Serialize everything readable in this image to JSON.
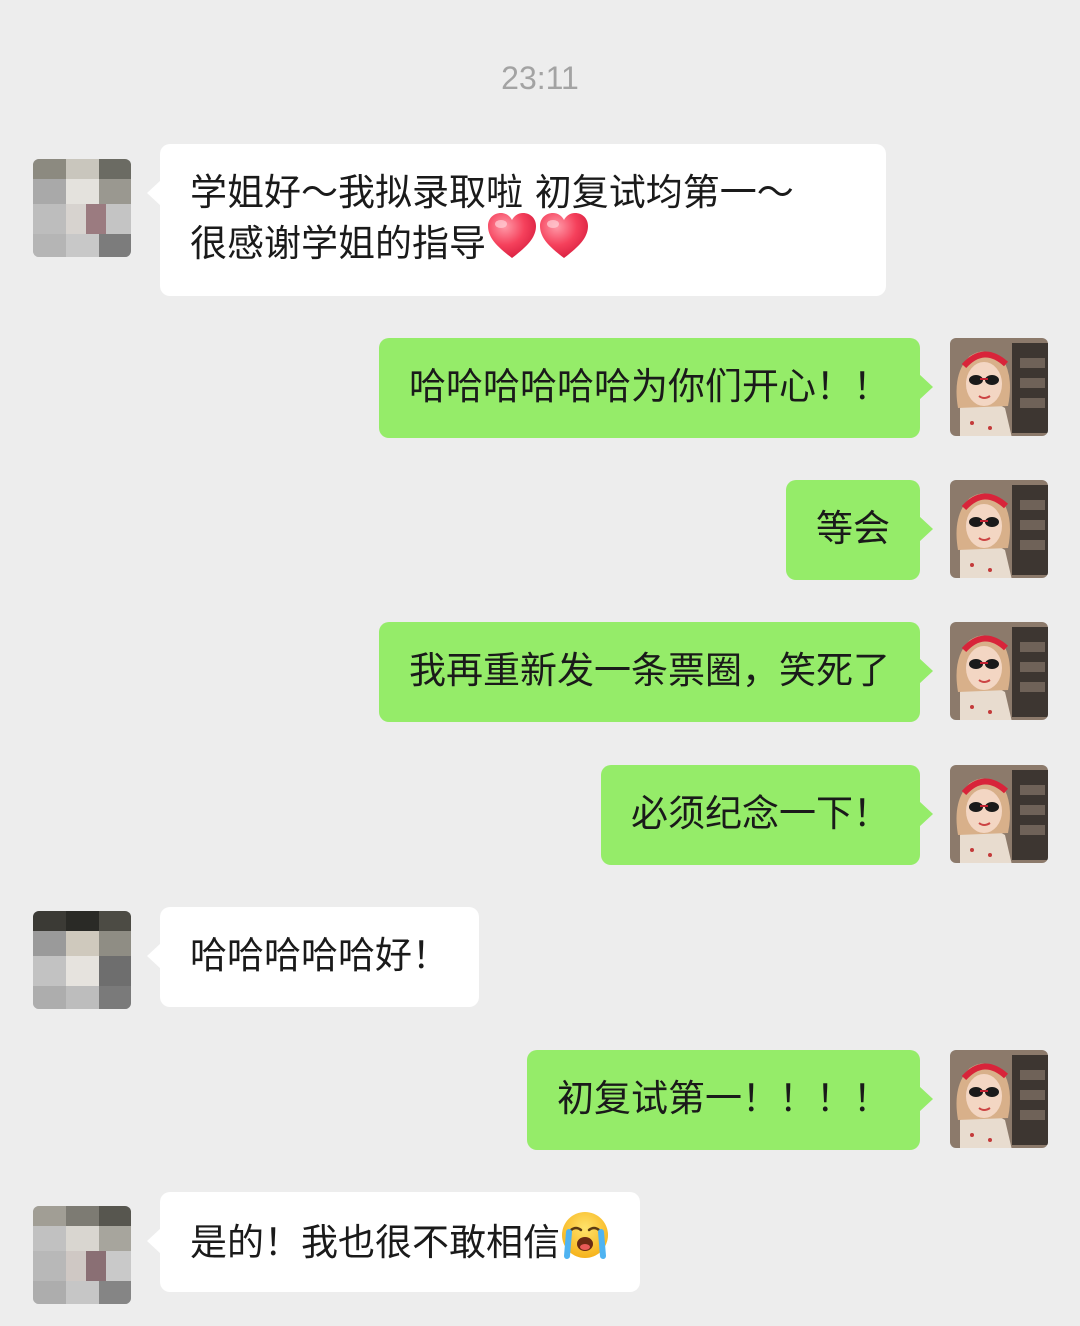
{
  "chat": {
    "timestamp": "23:11",
    "messages": [
      {
        "side": "in",
        "avatar": "pixelated-avatar",
        "lines": [
          "学姐好～我拟录取啦 初复试均第一～",
          "很感谢学姐的指导"
        ],
        "trailing_icons": [
          "heart-icon",
          "heart-icon"
        ]
      },
      {
        "side": "out",
        "avatar": "girl-sunglasses-avatar",
        "text": "哈哈哈哈哈哈为你们开心！！"
      },
      {
        "side": "out",
        "avatar": "girl-sunglasses-avatar",
        "text": "等会"
      },
      {
        "side": "out",
        "avatar": "girl-sunglasses-avatar",
        "text": "我再重新发一条票圈，笑死了"
      },
      {
        "side": "out",
        "avatar": "girl-sunglasses-avatar",
        "text": "必须纪念一下！"
      },
      {
        "side": "in",
        "avatar": "pixelated-avatar",
        "text": "哈哈哈哈哈好！"
      },
      {
        "side": "out",
        "avatar": "girl-sunglasses-avatar",
        "text": "初复试第一！！！！"
      },
      {
        "side": "in",
        "avatar": "pixelated-avatar",
        "text": "是的！我也很不敢相信",
        "trailing_icons": [
          "loudly-crying-face-icon"
        ]
      }
    ]
  },
  "colors": {
    "background": "#ededed",
    "incoming_bubble": "#ffffff",
    "outgoing_bubble": "#95ec69",
    "timestamp_text": "#a3a3a3"
  }
}
